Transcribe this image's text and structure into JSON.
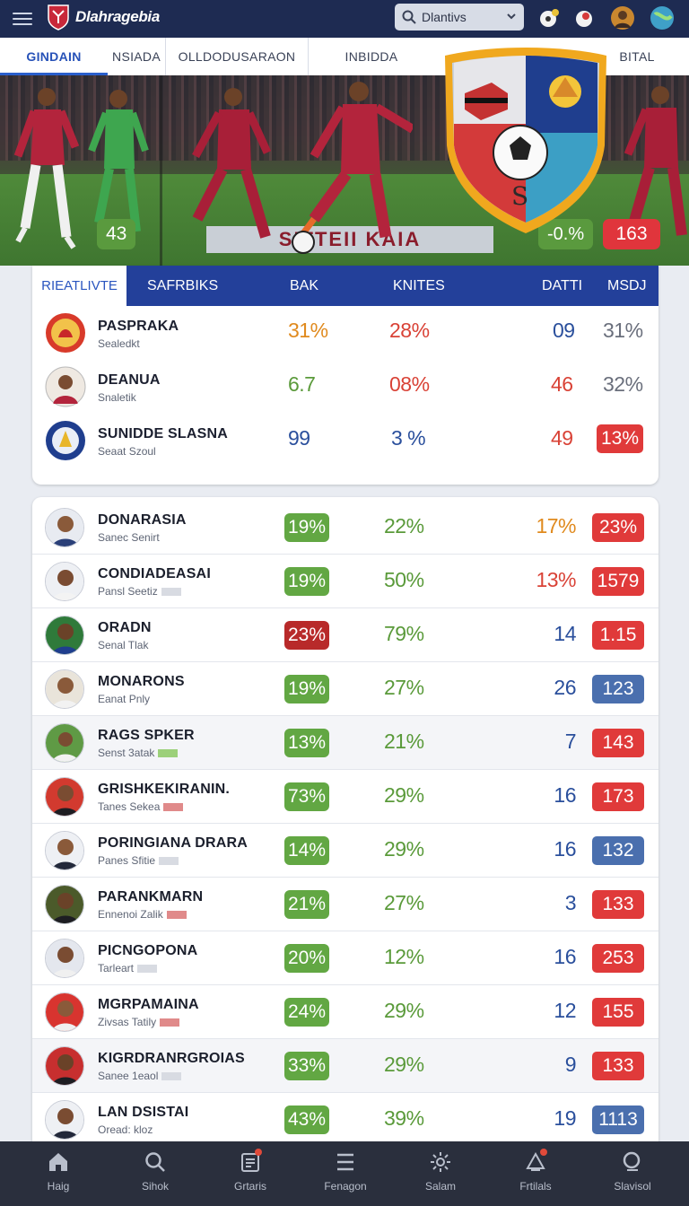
{
  "header": {
    "brand": "Dlahragebia",
    "search_value": "Dlantivs"
  },
  "nav_tabs": [
    "GINDAIN",
    "NSIADA",
    "OLLDODUSARAON",
    "INBIDDA",
    "BITAL"
  ],
  "hero": {
    "score_left": "43",
    "score_mid": "-0.%",
    "score_right": "163",
    "adboard": "SITTEII KAIA"
  },
  "standings": {
    "tabs": [
      "RIEATLIVTE",
      "SAFRBIKS",
      "BAK",
      "KNITES",
      "DATTI",
      "MSDJ"
    ],
    "rows": [
      {
        "name": "PASPRAKA",
        "sub": "Sealedkt",
        "c1": "31%",
        "c2": "28%",
        "c3": "09",
        "c4": "31%"
      },
      {
        "name": "DEANUA",
        "sub": "Snaletik",
        "c1": "6.7",
        "c2": "08%",
        "c3": "46",
        "c4": "32%"
      },
      {
        "name": "SUNIDDE SLASNA",
        "sub": "Seaat Szoul",
        "c1": "99",
        "c2": "3 %",
        "c3": "49",
        "c4": "13%"
      }
    ]
  },
  "players": [
    {
      "name": "DONARASIA",
      "sub": "Sanec Senirt",
      "g": "19%",
      "p": "22%",
      "n": "17%",
      "r": "23%",
      "gcolor": "#62a743",
      "ncolor": "#e08a1e",
      "rcolor": "#e03a3a"
    },
    {
      "name": "CONDIADEASAI",
      "sub": "Pansl Seetiz",
      "g": "19%",
      "p": "50%",
      "n": "13%",
      "r": "1579",
      "gcolor": "#62a743",
      "ncolor": "#d94236",
      "rcolor": "#e03a3a"
    },
    {
      "name": "ORADN",
      "sub": "Senal Tlak",
      "g": "23%",
      "p": "79%",
      "n": "14",
      "r": "1.15",
      "gcolor": "#b82a2a",
      "ncolor": "#2a4f9c",
      "rcolor": "#e03a3a"
    },
    {
      "name": "MONARONS",
      "sub": "Eanat Pnly",
      "g": "19%",
      "p": "27%",
      "n": "26",
      "r": "123",
      "gcolor": "#62a743",
      "ncolor": "#2a4f9c",
      "rcolor": "#4a6fae"
    },
    {
      "name": "RAGS SPKER",
      "sub": "Senst 3atak",
      "g": "13%",
      "p": "21%",
      "n": "7",
      "r": "143",
      "gcolor": "#62a743",
      "ncolor": "#2a4f9c",
      "rcolor": "#e03a3a"
    },
    {
      "name": "GRISHKEKIRANIN.",
      "sub": "Tanes Sekea",
      "g": "73%",
      "p": "29%",
      "n": "16",
      "r": "173",
      "gcolor": "#62a743",
      "ncolor": "#2a4f9c",
      "rcolor": "#e03a3a"
    },
    {
      "name": "PORINGIANA DRARA",
      "sub": "Panes Sfitie",
      "g": "14%",
      "p": "29%",
      "n": "16",
      "r": "132",
      "gcolor": "#62a743",
      "ncolor": "#2a4f9c",
      "rcolor": "#4a6fae"
    },
    {
      "name": "PARANKMARN",
      "sub": "Ennenoi Zalik",
      "g": "21%",
      "p": "27%",
      "n": "3",
      "r": "133",
      "gcolor": "#62a743",
      "ncolor": "#2a4f9c",
      "rcolor": "#e03a3a"
    },
    {
      "name": "PICNGOPONA",
      "sub": "Tarleart",
      "g": "20%",
      "p": "12%",
      "n": "16",
      "r": "253",
      "gcolor": "#62a743",
      "ncolor": "#2a4f9c",
      "rcolor": "#e03a3a"
    },
    {
      "name": "MGRPAMAINA",
      "sub": "Zivsas Tatily",
      "g": "24%",
      "p": "29%",
      "n": "12",
      "r": "155",
      "gcolor": "#62a743",
      "ncolor": "#2a4f9c",
      "rcolor": "#e03a3a"
    },
    {
      "name": "KIGRDRANRGROIAS",
      "sub": "Sanee 1eaol",
      "g": "33%",
      "p": "29%",
      "n": "9",
      "r": "133",
      "gcolor": "#62a743",
      "ncolor": "#2a4f9c",
      "rcolor": "#e03a3a"
    },
    {
      "name": "LAN DSISTAI",
      "sub": "Oread: kloz",
      "g": "43%",
      "p": "39%",
      "n": "19",
      "r": "1113",
      "gcolor": "#62a743",
      "ncolor": "#2a4f9c",
      "rcolor": "#4a6fae"
    }
  ],
  "bottom_nav": [
    "Haig",
    "Sihok",
    "Grtaris",
    "Fenagon",
    "Salam",
    "Frtilals",
    "Slavisol"
  ],
  "colors": {
    "header_bg": "#1e2b52",
    "accent_blue": "#23409a",
    "green": "#62a743",
    "red": "#e03a3a",
    "blue_num": "#2a4f9c"
  }
}
